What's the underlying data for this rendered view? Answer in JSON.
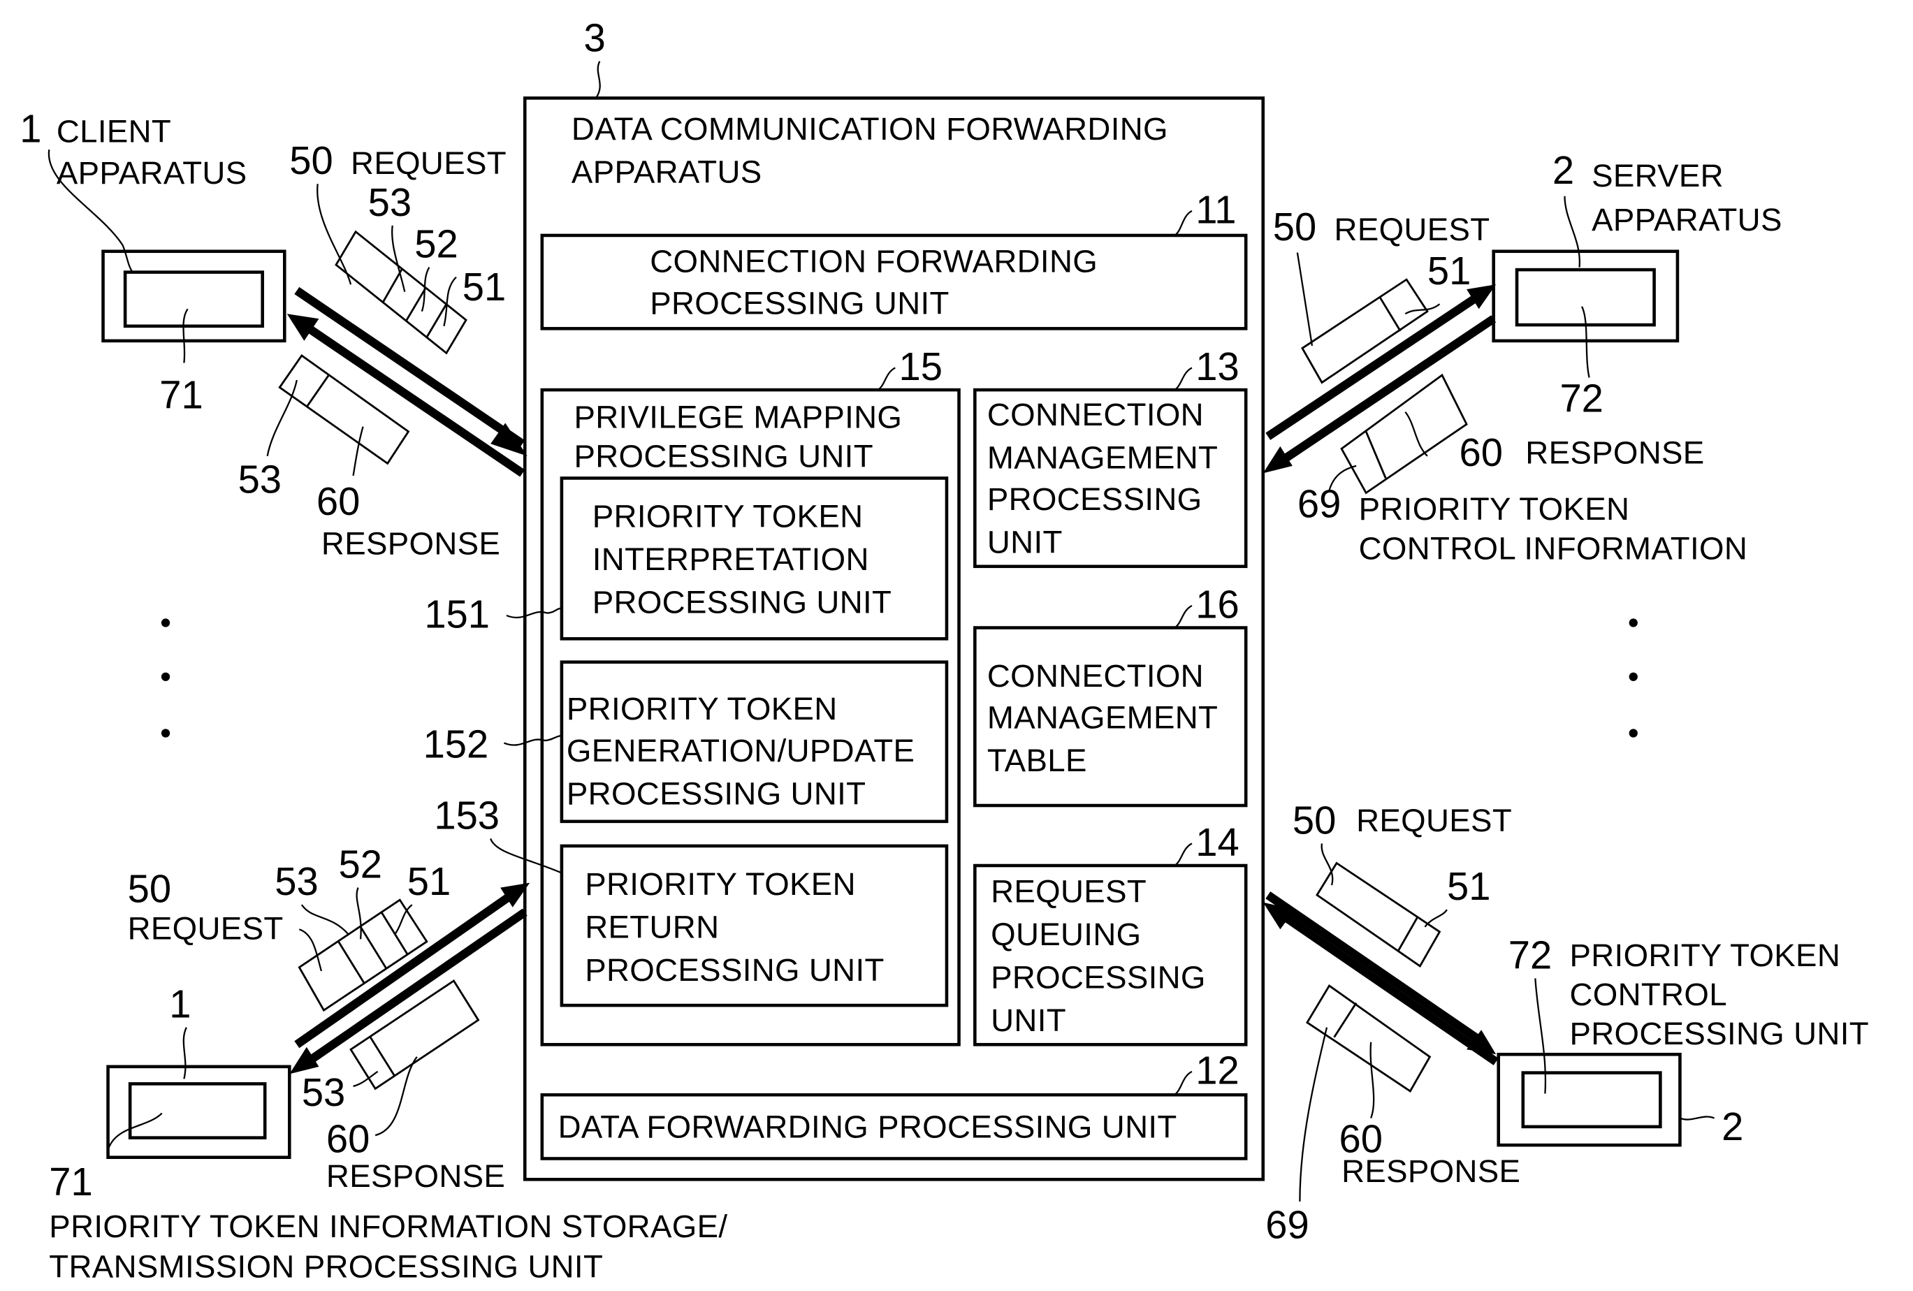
{
  "figure": {
    "apparatus": {
      "ref": "3",
      "title_lines": [
        "DATA COMMUNICATION FORWARDING",
        "APPARATUS"
      ],
      "units": {
        "connection_forwarding": {
          "ref": "11",
          "lines": [
            "CONNECTION FORWARDING",
            "PROCESSING UNIT"
          ]
        },
        "privilege_mapping": {
          "ref": "15",
          "lines": [
            "PRIVILEGE MAPPING",
            "PROCESSING UNIT"
          ]
        },
        "token_interpretation": {
          "ref": "151",
          "lines": [
            "PRIORITY TOKEN",
            "INTERPRETATION",
            "PROCESSING UNIT"
          ]
        },
        "token_generation": {
          "ref": "152",
          "lines": [
            "PRIORITY TOKEN",
            "GENERATION/UPDATE",
            "PROCESSING UNIT"
          ]
        },
        "token_return": {
          "ref": "153",
          "lines": [
            "PRIORITY TOKEN",
            "RETURN",
            "PROCESSING UNIT"
          ]
        },
        "connection_management": {
          "ref": "13",
          "lines": [
            "CONNECTION",
            "MANAGEMENT",
            "PROCESSING",
            "UNIT"
          ]
        },
        "connection_table": {
          "ref": "16",
          "lines": [
            "CONNECTION",
            "MANAGEMENT",
            "TABLE"
          ]
        },
        "request_queuing": {
          "ref": "14",
          "lines": [
            "REQUEST",
            "QUEUING",
            "PROCESSING",
            "UNIT"
          ]
        },
        "data_forwarding": {
          "ref": "12",
          "lines": [
            "DATA FORWARDING PROCESSING UNIT"
          ]
        }
      }
    },
    "client_top": {
      "ref": "1",
      "lines": [
        "CLIENT",
        "APPARATUS"
      ],
      "inner_ref": "71",
      "request": {
        "ref": "50",
        "label": "REQUEST",
        "fields": [
          "53",
          "52",
          "51"
        ]
      },
      "response": {
        "ref": "60",
        "label": "RESPONSE",
        "field": "53"
      }
    },
    "server_top": {
      "ref": "2",
      "lines": [
        "SERVER",
        "APPARATUS"
      ],
      "inner_ref": "72",
      "request": {
        "ref": "50",
        "label": "REQUEST",
        "field": "51"
      },
      "response": {
        "ref": "60",
        "label": "RESPONSE"
      },
      "control_info": {
        "ref": "69",
        "lines": [
          "PRIORITY TOKEN",
          "CONTROL INFORMATION"
        ]
      }
    },
    "client_bottom": {
      "ref": "1",
      "inner_ref": "71",
      "request": {
        "ref": "50",
        "label": "REQUEST",
        "fields": [
          "53",
          "52",
          "51"
        ]
      },
      "response": {
        "ref": "60",
        "label": "RESPONSE",
        "field": "53"
      },
      "storage_lines": [
        "PRIORITY TOKEN INFORMATION STORAGE/",
        "TRANSMISSION PROCESSING UNIT"
      ]
    },
    "server_bottom": {
      "ref": "2",
      "inner_ref": "72",
      "inner_lines": [
        "PRIORITY TOKEN",
        "CONTROL",
        "PROCESSING UNIT"
      ],
      "request": {
        "ref": "50",
        "label": "REQUEST",
        "field": "51"
      },
      "response": {
        "ref": "60",
        "label": "RESPONSE"
      },
      "control_ref": "69"
    },
    "ellipsis": "..."
  }
}
